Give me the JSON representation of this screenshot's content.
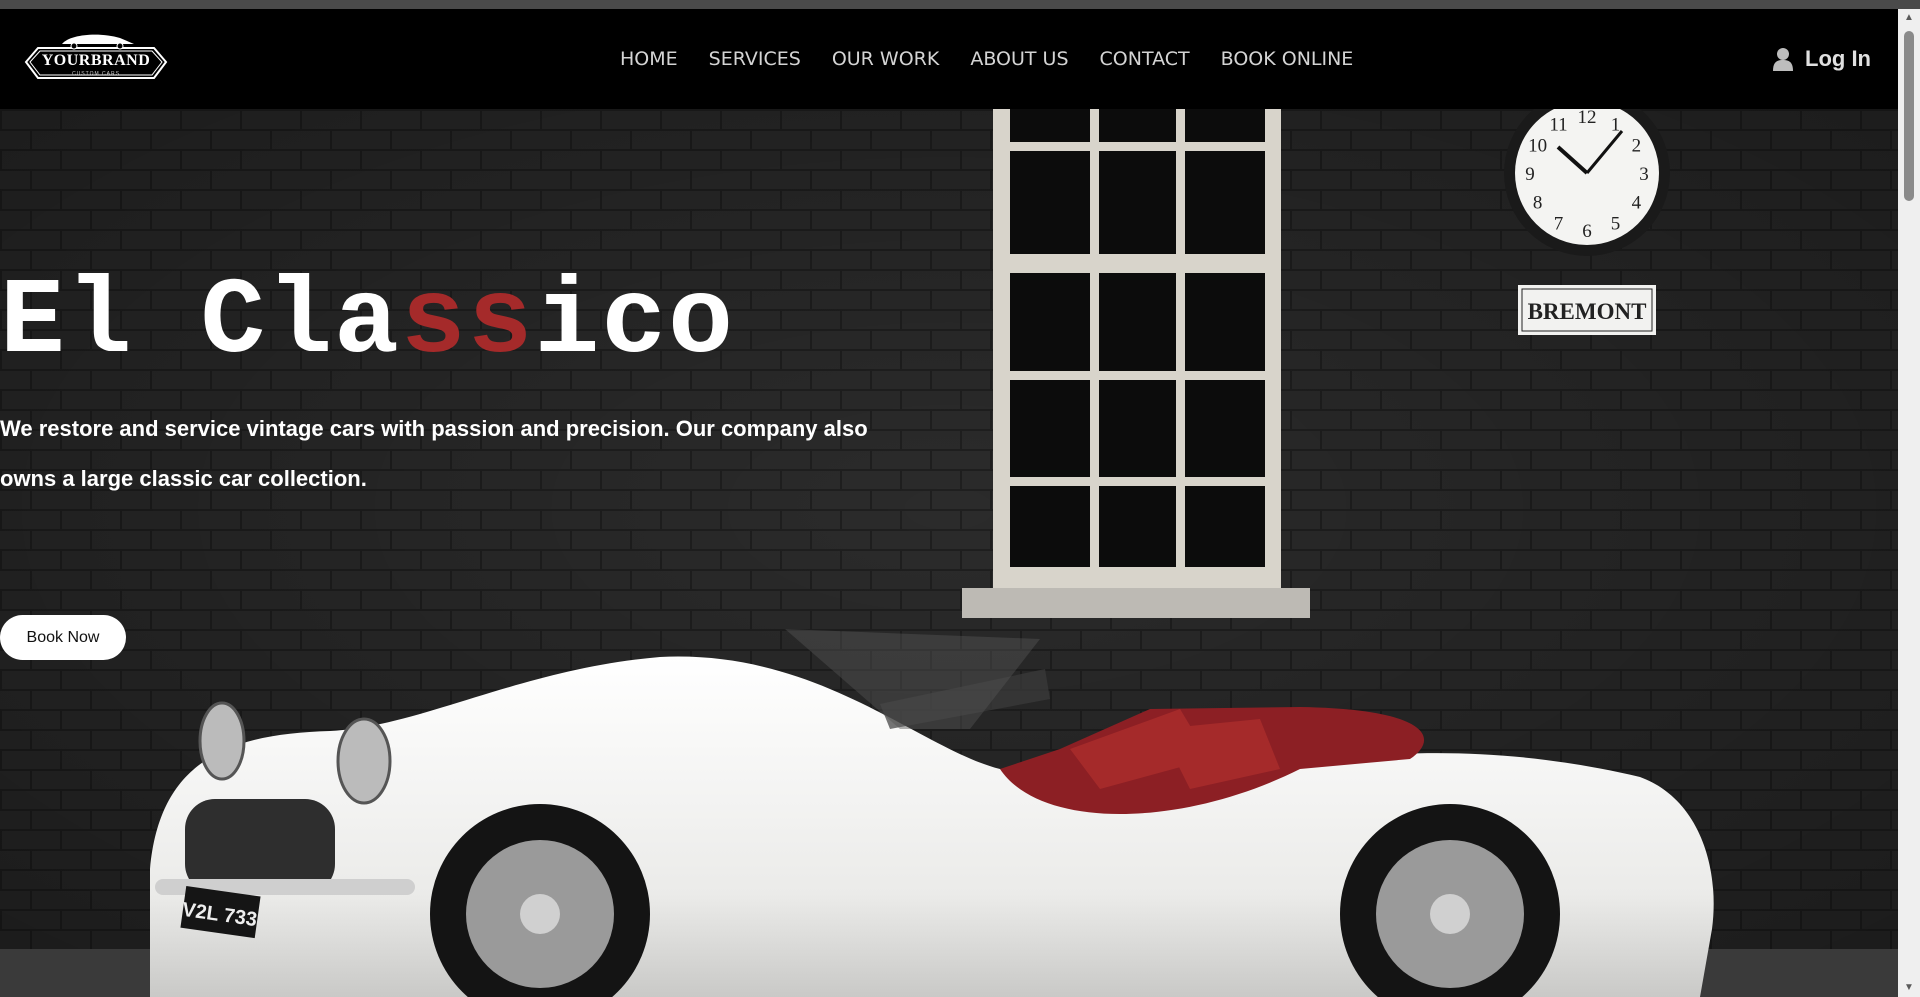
{
  "brand": {
    "name": "YOURBRAND",
    "sub": "CUSTOM CARS"
  },
  "nav": {
    "items": [
      {
        "label": "HOME"
      },
      {
        "label": "SERVICES"
      },
      {
        "label": "OUR WORK"
      },
      {
        "label": "ABOUT US"
      },
      {
        "label": "CONTACT"
      },
      {
        "label": "BOOK ONLINE"
      }
    ],
    "login_label": "Log In"
  },
  "hero": {
    "title_part1": "El Cla",
    "title_accent": "ss",
    "title_part2": "ico",
    "tagline": "We restore and service vintage cars with passion and precision. Our company also owns a large classic car collection.",
    "cta_label": "Book Now",
    "sign_text": "BREMONT",
    "plate_text": "V2L 733",
    "clock_numbers": [
      "12",
      "1",
      "2",
      "3",
      "4",
      "5",
      "6",
      "7",
      "8",
      "9",
      "10",
      "11"
    ]
  },
  "colors": {
    "accent": "#a52a2a",
    "navbar": "#000000",
    "wall": "#2b2b2b",
    "car_body": "#f2f2f0",
    "upholstery": "#8c1f24"
  }
}
